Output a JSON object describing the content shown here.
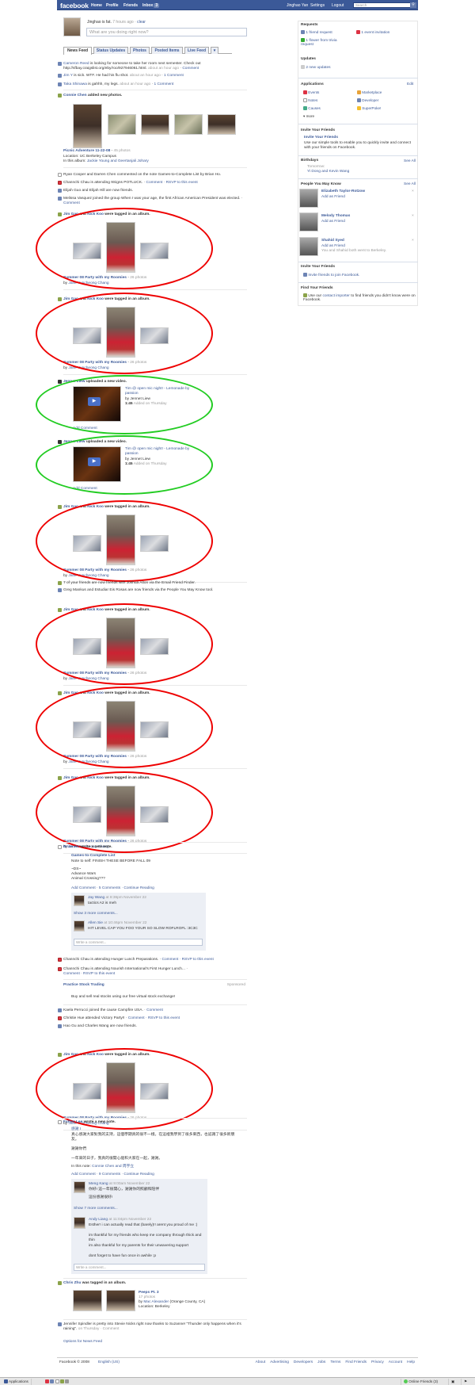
{
  "topbar": {
    "logo": "facebook",
    "nav": [
      "Home",
      "Profile",
      "Friends",
      "Inbox"
    ],
    "inbox_count": "3",
    "user_name": "Jinghao Yan",
    "settings": "Settings",
    "logout": "Logout",
    "search_placeholder": "Search"
  },
  "status": {
    "name": "Jinghao",
    "text": "is fat.",
    "time": "7 hours ago",
    "clear": "clear",
    "input_placeholder": "What are you doing right now?"
  },
  "tabs": [
    "News Feed",
    "Status Updates",
    "Photos",
    "Posted Items",
    "Live Feed"
  ],
  "feed": {
    "item1_name": "Cameron Reed",
    "item1_text": "is looking for someone to take her room next semester. Check out http://sfbay.craigslist.org/eby/roo/927946061.html.",
    "item1_meta": "about an hour ago",
    "item1_comment": "Comment",
    "item2_name": "Jim Y",
    "item2_text": "is sick. WTF. He had his flu shot.",
    "item2_meta": "about an hour ago",
    "item2_comment": "1 Comment",
    "item3_name": "Taka Shinawa",
    "item3_text": "is gahhh, my legs.",
    "item3_meta": "about an hour ago",
    "item3_comment": "1 Comment",
    "photos_actor": "Connie Chen",
    "photos_action": "added new photos.",
    "album_title": "Picnic Adventure 11-22-08",
    "album_count": "45 photos",
    "album_location": "Location: UC Berkeley Campus",
    "album_in": "In this album:",
    "album_people": "Jackie Young and Geertanjali Johary",
    "line_ryan": "Ryan Cooper and Darren Chen commented on the note Games-to-Complete List by Brian Ho.",
    "line_channchi": "Channchi Chau is attending 9Signs POTLUCK.",
    "line_channchi_meta": "Comment · RSVP to this event",
    "line_elijah": "Elijah Guo and Elijah Hill are now friends.",
    "line_melissa": "Melissa Vasquez joined the group When I was your age, the first African American President was elected.",
    "line_melissa_meta": "Comment",
    "tag_actor": "Jim Gao",
    "tag_and": "and",
    "tag_actor2": "Nick Koo",
    "tag_action": "were tagged in an album.",
    "tag_album": "Summer 08 Party with my Roomies",
    "tag_count": "26 photos",
    "tag_by": "by",
    "tag_owner": "Jane Yuncheong Chang",
    "video_actor": "Jennet Liew",
    "video_action": "uploaded a new video.",
    "video_title": "Tim @ open mic night! - Lemonade by passion",
    "video_by": "by Jennet Liew",
    "video_len": "1:45",
    "video_added": "Added on Thursday",
    "video_add_comment": "Add Comment",
    "line_friends4": "7 of your friends are now friends with Joshua Alton via the Email Friend Finder.",
    "line_greg": "Greg Mankus and Estudiar Eis Rosas are now friends via the People You May Know tool.",
    "note_actor": "Brian Ho",
    "note_action": "wrote a new note.",
    "note_title": "Games-to-Complete List",
    "note_l1": "Note to self: FINISH THESE BEFORE FALL 09",
    "note_l2": "~DS~",
    "note_l3": "Advance Wars",
    "note_l4": "Animal Crossing???",
    "note_links": "Add Comment · 5 Comments · Continue Reading",
    "c1_name": "Jay Wang",
    "c1_meta": "at 8:36pm November 22",
    "c1_text": "tactics A2 is meh",
    "c_show": "Show 3 more comments...",
    "c2_name": "Allen Sie",
    "c2_meta": "at 10:46pm November 22",
    "c2_text": "HIT LEVEL CAP YOU FOO YOUR SO SLOW ROFLROFL :3C3C",
    "write_comment": "Write a comment...",
    "line_hunger": "Channchi Chau is attending Hunger Lunch Preparations.",
    "line_hunger_meta": "Comment · RSVP to this event",
    "line_nourish": "Channchi Chau is attending Nourish International's First Hunger Lunch...",
    "line_nourish_meta": "Comment · RSVP to this event",
    "ad_title": "Practice Stock Trading",
    "ad_sponsored": "Sponsored",
    "ad_text": "Buy and sell real stocks using our free virtual stock exchange!",
    "line_kaela": "Kaela Perrucci joined the cause Campfire USA.",
    "line_kaela_meta": "Comment",
    "line_christie": "Christie Hue attended Victory Party!!",
    "line_christie_meta": "Comment · RSVP to this event",
    "line_hao": "Hao Gu and Charles Wang are now friends.",
    "note2_actor": "Father Lee",
    "note2_action": "wrote a new note.",
    "note2_title": "感謝 I",
    "note2_body": "真心感謝大家對我的支持，這個學期真的很不一樣。在這裡我學到了很多東西，也認識了很多新朋友。",
    "note2_l2": "謝謝你們",
    "note2_l3": "一年來的日子，我真的很開心能和大家在一起，謝謝。",
    "note2_in": "In this note:",
    "note2_tagged": "Connie Chen and 周宇立",
    "note2_links": "Add Comment · 9 Comments · Continue Reading",
    "n2c1_name": "Meng Kang",
    "n2c1_meta": "at 9:00am November 22",
    "n2c1_text": "你好! 這一年很開心，謝謝你的照顧和陪伴",
    "n2c1_text2": "這份感謝很好!",
    "n2c_show": "Show 7 more comments...",
    "n2c2_name": "Andy Liang",
    "n2c2_meta": "at 11:04pm November 22",
    "n2c2_t1": "Esther! i can actually read that (barely)!! arent you proud of me :)",
    "n2c2_t2": "im thankful for my friends who keep me company through thick and thin",
    "n2c2_t3": "im also thankful for my parents for their unwavering support",
    "n2c2_t4": "dont forget to have fun once in awhile :p",
    "chris_actor": "Chris Zhu",
    "chris_action": "was tagged in an album.",
    "peeps_title": "Peeps Pt. 3",
    "peeps_count": "17 photos",
    "peeps_by": "by",
    "peeps_owner": "Mac Alexander",
    "peeps_where": "(Orange County, CA)",
    "peeps_loc": "Location: Berkeley",
    "line_jennifer": "Jennifer Spindler is pretty into Stevie Nicks right now thanks to Suzanne! \"Thunder only happens when it's raining\".",
    "line_jennifer_meta": "on Thursday · Comment",
    "options": "Options for News Feed"
  },
  "right": {
    "requests_h": "Requests",
    "req1": "1 friend request",
    "req2": "1 event invitation",
    "req3": "1 flower from trivia request",
    "updates_h": "Updates",
    "upd1": "2 new updates",
    "apps_h": "Applications",
    "apps_edit": "Edit",
    "apps": [
      "Events",
      "Marketplace",
      "Notes",
      "Developer",
      "Causes",
      "SuperPoke!"
    ],
    "apps_more": "more",
    "invite_h": "Invite Your Friends",
    "invite_link": "Invite Your Friends",
    "invite_text": "Use our simple tools to enable you to quickly invite and connect with your friends on Facebook.",
    "bday_h": "Birthdays",
    "bday_all": "See All",
    "bday_when": "Tomorrow:",
    "bday_who": "Yi Dong and Kevin Wang",
    "pymk_h": "People You May Know",
    "pymk_all": "See All",
    "pymk": [
      {
        "name": "Elizabeth Taylor-Rotzow",
        "add": "Add as Friend",
        "x": "×"
      },
      {
        "name": "Melody Thomas",
        "add": "Add as Friend",
        "x": "×"
      },
      {
        "name": "Shahid Syed",
        "add": "Add as Friend",
        "note": "You and Shahid both went to Berkeley.",
        "x": "×"
      }
    ],
    "invite2_h": "Invite Your Friends",
    "invite2_link": "Invite friends to join Facebook.",
    "find_h": "Find Your Friends",
    "find_text_pre": "Use our",
    "find_link": "contact importer",
    "find_text_post": "to find friends you didn't know were on Facebook."
  },
  "footer": {
    "copyright": "Facebook © 2008",
    "lang": "English (US)",
    "links": [
      "About",
      "Advertising",
      "Developers",
      "Jobs",
      "Terms",
      "Find Friends",
      "Privacy",
      "Account",
      "Help"
    ]
  },
  "taskbar": {
    "apps": "Applications",
    "online": "Online Friends (3)"
  },
  "colors": {
    "fb_blue": "#3b5998",
    "oval_red": "#ee0000",
    "oval_green": "#22cc22"
  }
}
